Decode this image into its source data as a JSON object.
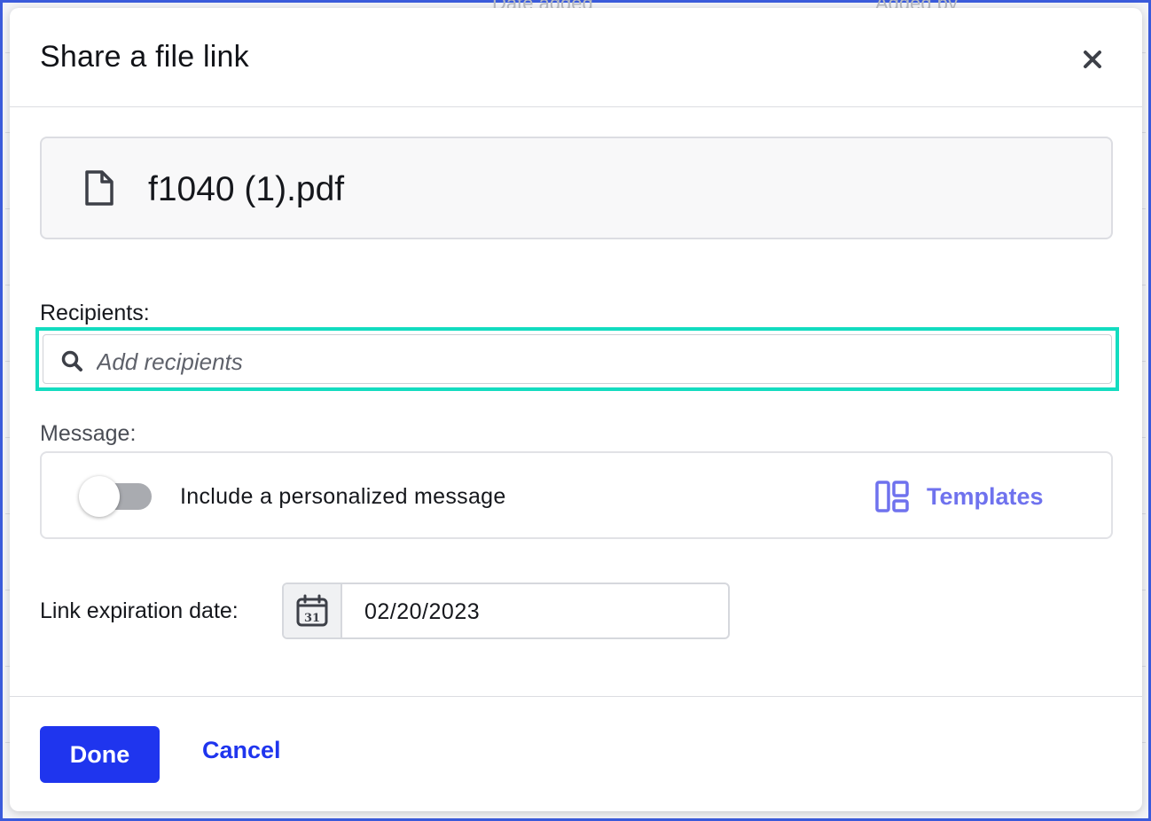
{
  "background": {
    "columns": [
      "Date added",
      "Added by"
    ]
  },
  "modal": {
    "title": "Share a file link",
    "close_icon": "close-icon"
  },
  "file": {
    "name": "f1040 (1).pdf",
    "icon": "file-icon"
  },
  "recipients": {
    "label": "Recipients:",
    "placeholder": "Add recipients",
    "value": "",
    "icon": "search-icon",
    "focus_color": "#13dcc0"
  },
  "message": {
    "label": "Message:",
    "toggle_label": "Include a personalized message",
    "toggle_on": false,
    "templates_label": "Templates",
    "templates_icon": "templates-layout-icon"
  },
  "expiration": {
    "label": "Link expiration date:",
    "value": "02/20/2023",
    "icon": "calendar-icon",
    "calendar_day": "31"
  },
  "footer": {
    "done_label": "Done",
    "cancel_label": "Cancel"
  },
  "colors": {
    "primary": "#1f35ee",
    "templates_accent": "#6f72ee",
    "focus_ring": "#13dcc0"
  }
}
